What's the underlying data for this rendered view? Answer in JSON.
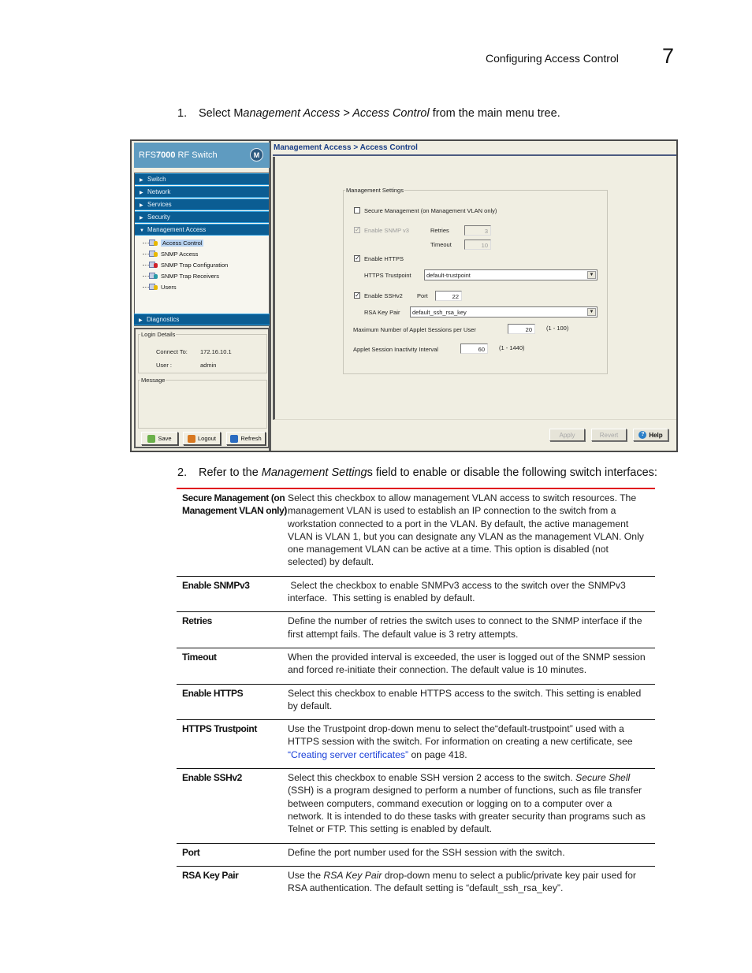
{
  "page_header": {
    "title": "Configuring Access Control",
    "chapter": "7"
  },
  "steps": [
    {
      "num": "1.",
      "pre": "Select M",
      "em1": "anagement Access > Access Control",
      "post": " from the main menu tree."
    },
    {
      "num": "2.",
      "pre": "Refer to the ",
      "em1": "Management Setting",
      "post": "s field to enable or disable the following switch interfaces:"
    }
  ],
  "app": {
    "brand_prefix": "RFS",
    "brand_bold": "7000",
    "brand_suffix": " RF Switch",
    "logo": "M",
    "nav": [
      {
        "label": "Switch",
        "expanded": false
      },
      {
        "label": "Network",
        "expanded": false
      },
      {
        "label": "Services",
        "expanded": false
      },
      {
        "label": "Security",
        "expanded": false
      },
      {
        "label": "Management Access",
        "expanded": true
      }
    ],
    "tree": [
      {
        "label": "Access Control",
        "selected": true
      },
      {
        "label": "SNMP Access",
        "selected": false
      },
      {
        "label": "SNMP Trap Configuration",
        "selected": false
      },
      {
        "label": "SNMP Trap Receivers",
        "selected": false
      },
      {
        "label": "Users",
        "selected": false
      }
    ],
    "nav_diagnostics": "Diagnostics",
    "login": {
      "legend": "Login Details",
      "connect_label": "Connect To:",
      "connect_value": "172.16.10.1",
      "user_label": "User :",
      "user_value": "admin"
    },
    "message_legend": "Message",
    "sidebar_buttons": {
      "save": "Save",
      "logout": "Logout",
      "refresh": "Refresh"
    },
    "breadcrumb": "Management Access > Access Control",
    "form": {
      "legend": "Management Settings",
      "secure_mgmt": {
        "label": "Secure Management (on Management VLAN only)",
        "checked": false
      },
      "snmp_v3": {
        "label": "Enable SNMP v3",
        "checked": true,
        "disabled": true
      },
      "retries": {
        "label": "Retries",
        "value": "3"
      },
      "timeout": {
        "label": "Timeout",
        "value": "10"
      },
      "https": {
        "label": "Enable HTTPS",
        "checked": true
      },
      "trustpoint": {
        "label": "HTTPS Trustpoint",
        "value": "default-trustpoint"
      },
      "sshv2": {
        "label": "Enable SSHv2",
        "checked": true
      },
      "port": {
        "label": "Port",
        "value": "22"
      },
      "rsa": {
        "label": "RSA Key Pair",
        "value": "default_ssh_rsa_key"
      },
      "max_sessions": {
        "label": "Maximum Number of Applet Sessions per User",
        "value": "20",
        "range": "(1 - 100)"
      },
      "inactivity": {
        "label": "Applet Session Inactivity Interval",
        "value": "60",
        "range": "(1 - 1440)"
      }
    },
    "buttons": {
      "apply": "Apply",
      "revert": "Revert",
      "help": "Help"
    }
  },
  "table": [
    {
      "term": "Secure Management (on Management VLAN only)",
      "desc": "Select this checkbox to allow management VLAN access to switch resources. The management VLAN is used to establish an IP connection to the switch from a workstation connected to a port in the VLAN. By default, the active management VLAN is VLAN 1, but you can designate any VLAN as the management VLAN. Only one management VLAN can be active at a time. This option is disabled (not selected) by default."
    },
    {
      "term": "Enable SNMPv3",
      "desc": " Select the checkbox to enable SNMPv3 access to the switch over the SNMPv3 interface.  This setting is enabled by default."
    },
    {
      "term": "Retries",
      "desc": "Define the number of retries the switch uses to connect to the SNMP interface if the first attempt fails. The default value is 3 retry attempts."
    },
    {
      "term": "Timeout",
      "desc": "When the provided interval is exceeded, the user is logged out of the SNMP session and forced re-initiate their connection. The default value is 10 minutes."
    },
    {
      "term": "Enable HTTPS",
      "desc": "Select this checkbox to enable HTTPS access to the switch. This setting is enabled by default."
    },
    {
      "term": "HTTPS Trustpoint",
      "desc_pre": "Use the Trustpoint drop-down menu to select the“default-trustpoint” used with a HTTPS session with the switch. For information on creating a new certificate, see ",
      "link": "“Creating server certificates”",
      "desc_post": " on page 418."
    },
    {
      "term": "Enable SSHv2",
      "desc_pre": "Select this checkbox to enable SSH version 2 access to the switch. ",
      "em": "Secure Shell",
      "desc_post": " (SSH) is a program designed to perform a number of functions, such as file transfer between computers, command execution or logging on to a computer over a network. It is intended to do these tasks with greater security than programs such as Telnet or FTP. This setting is enabled by default."
    },
    {
      "term": "Port",
      "desc": "Define the port number used for the SSH session with the switch."
    },
    {
      "term": "RSA Key Pair",
      "desc_pre": "Use the ",
      "em": "RSA Key Pair",
      "desc_post": " drop-down menu to select a public/private key pair used for RSA authentication. The default setting is “default_ssh_rsa_key”."
    }
  ],
  "colors": {
    "rule_red": "#e0161e",
    "nav_blue": "#0b5d93",
    "brand_blue": "#5f9bc0",
    "link_blue": "#1a3fd8",
    "panel_bg": "#f0eee2"
  }
}
